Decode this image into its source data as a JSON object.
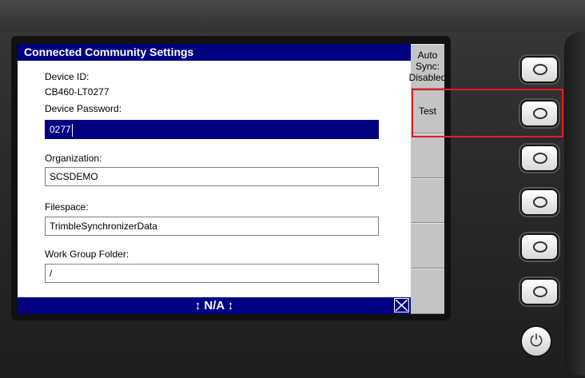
{
  "window": {
    "title": "Connected Community Settings"
  },
  "fields": {
    "device_id_label": "Device ID:",
    "device_id_value": "CB460-LT0277",
    "password_label": "Device Password:",
    "password_value": "0277",
    "organization_label": "Organization:",
    "organization_value": "SCSDEMO",
    "filespace_label": "Filespace:",
    "filespace_value": "TrimbleSynchronizerData",
    "workgroup_label": "Work Group Folder:",
    "workgroup_value": "/"
  },
  "status_bar": {
    "text": "↕ N/A ↕"
  },
  "softkeys": [
    {
      "label": "Auto Sync:\nDisabled"
    },
    {
      "label": "Test"
    },
    {
      "label": ""
    },
    {
      "label": ""
    },
    {
      "label": ""
    },
    {
      "label": ""
    }
  ],
  "icons": {
    "close": "close-x-icon",
    "power": "power-icon"
  },
  "colors": {
    "title_bar": "#000080",
    "active_field": "#000080",
    "softkey_bg": "#c4c4c4",
    "highlight": "#e02020"
  }
}
